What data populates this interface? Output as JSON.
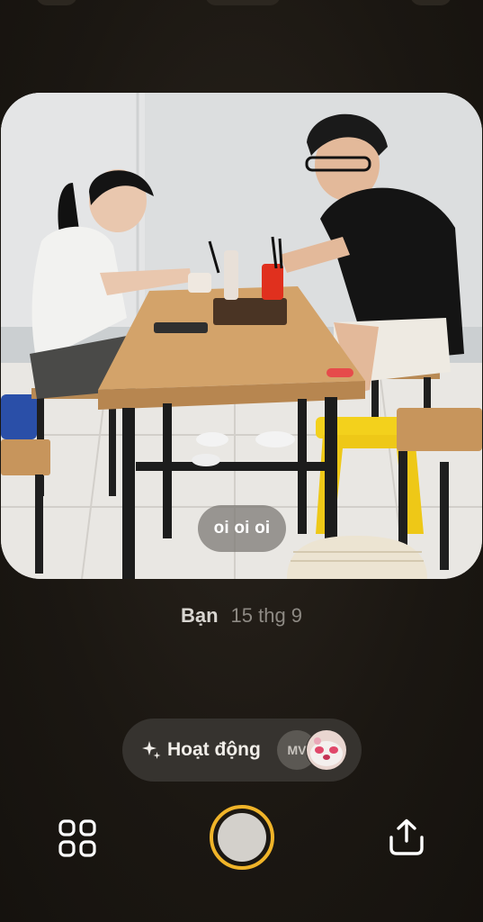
{
  "photo": {
    "caption": "oi oi oi",
    "image_description_icon": "photo-of-two-people-eating-at-table"
  },
  "meta": {
    "author": "Bạn",
    "date": "15 thg 9"
  },
  "activity": {
    "label": "Hoạt động",
    "icon": "sparkle-icon",
    "avatar_initials": "MV"
  },
  "toolbar": {
    "grid_icon": "grid-icon",
    "shutter_icon": "shutter-button",
    "share_icon": "share-icon"
  },
  "colors": {
    "background": "#1b1712",
    "accent": "#f0b429",
    "pill": "#36332f"
  }
}
